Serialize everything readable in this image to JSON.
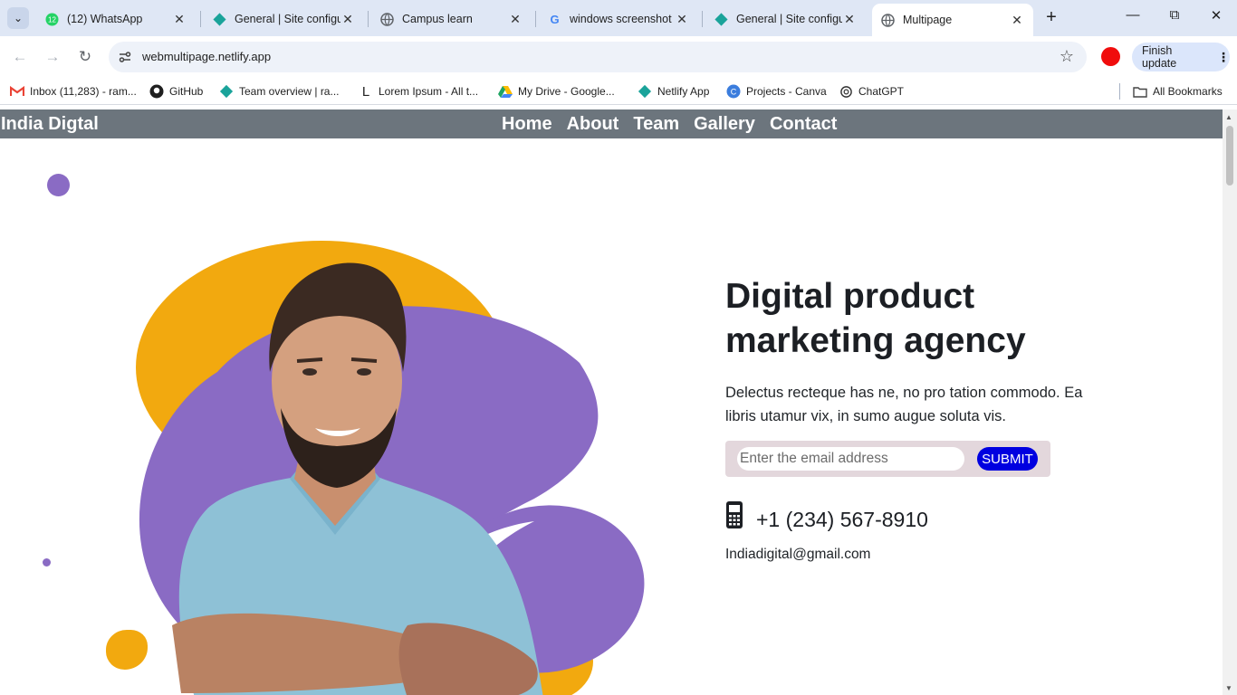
{
  "browser": {
    "tabs": [
      {
        "title": "(12) WhatsApp",
        "icon": "whatsapp-icon",
        "badge": "12"
      },
      {
        "title": "General | Site configu",
        "icon": "netlify-icon"
      },
      {
        "title": "Campus learn",
        "icon": "globe-icon"
      },
      {
        "title": "windows screenshot",
        "icon": "google-icon"
      },
      {
        "title": "General | Site configu",
        "icon": "netlify-icon"
      },
      {
        "title": "Multipage",
        "icon": "globe-icon",
        "active": true
      }
    ],
    "url": "webmultipage.netlify.app",
    "finish_update": "Finish update",
    "bookmarks": [
      {
        "label": "Inbox (11,283) - ram...",
        "icon": "gmail-icon"
      },
      {
        "label": "GitHub",
        "icon": "github-icon"
      },
      {
        "label": "Team overview | ra...",
        "icon": "netlify-icon"
      },
      {
        "label": "Lorem Ipsum - All t...",
        "icon": "lorem-icon"
      },
      {
        "label": "My Drive - Google...",
        "icon": "drive-icon"
      },
      {
        "label": "Netlify App",
        "icon": "netlify-icon"
      },
      {
        "label": "Projects - Canva",
        "icon": "canva-icon"
      },
      {
        "label": "ChatGPT",
        "icon": "chatgpt-icon"
      }
    ],
    "all_bookmarks": "All Bookmarks"
  },
  "site": {
    "brand": "India Digtal",
    "nav": [
      "Home",
      "About",
      "Team",
      "Gallery",
      "Contact"
    ],
    "headline": "Digital product marketing agency",
    "description": "Delectus recteque has ne, no pro tation commodo. Ea libris utamur vix, in sumo augue soluta vis.",
    "email_placeholder": "Enter the email address",
    "submit": "SUBMIT",
    "phone": "+1 (234) 567-8910",
    "email": "Indiadigital@gmail.com"
  },
  "colors": {
    "nav_bg": "#6c757d",
    "purple": "#8a6bc4",
    "yellow": "#f2a90f",
    "submit": "#0000e0"
  }
}
